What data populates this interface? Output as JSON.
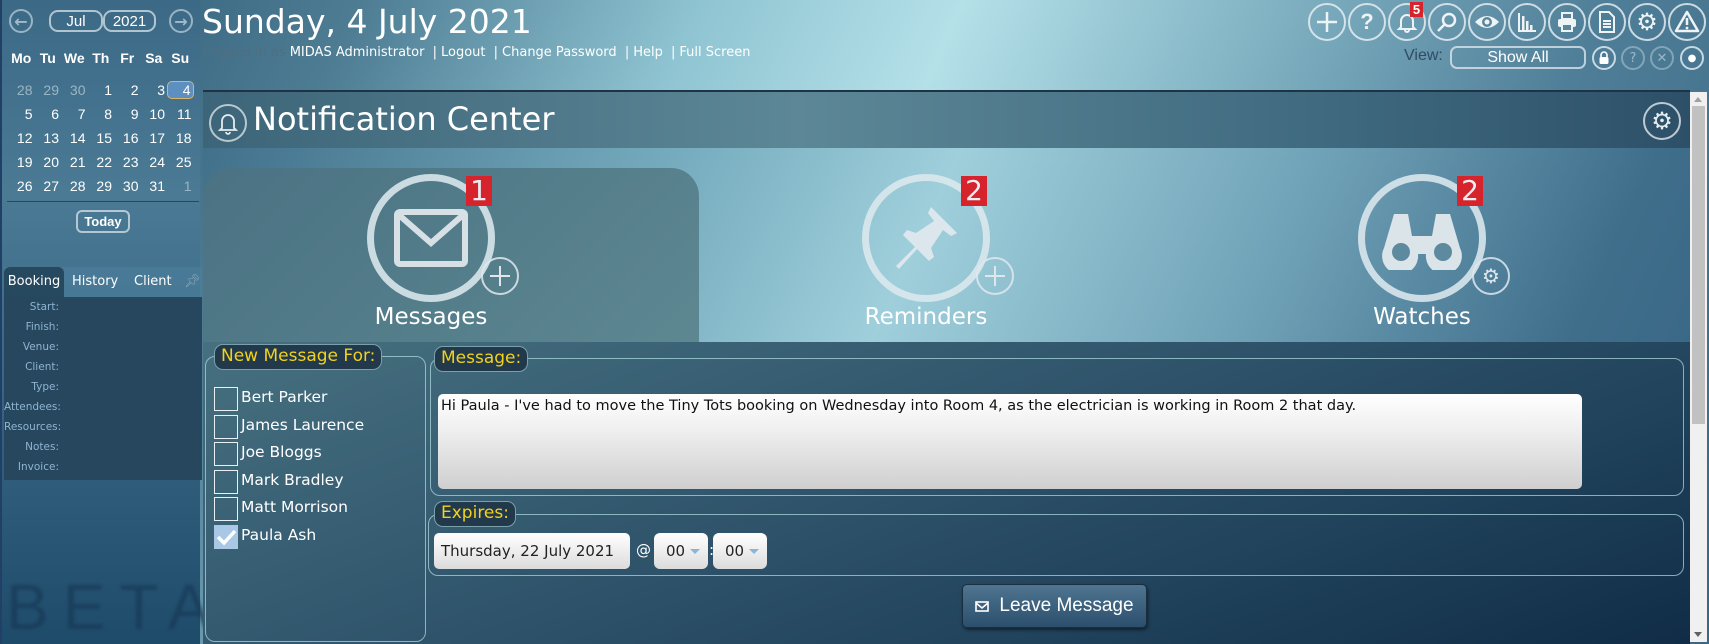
{
  "calendar": {
    "month": "Jul",
    "year": "2021",
    "weekdays": [
      "Mo",
      "Tu",
      "We",
      "Th",
      "Fr",
      "Sa",
      "Su"
    ],
    "weeks": [
      [
        "28",
        "29",
        "30",
        "1",
        "2",
        "3",
        "4"
      ],
      [
        "5",
        "6",
        "7",
        "8",
        "9",
        "10",
        "11"
      ],
      [
        "12",
        "13",
        "14",
        "15",
        "16",
        "17",
        "18"
      ],
      [
        "19",
        "20",
        "21",
        "22",
        "23",
        "24",
        "25"
      ],
      [
        "26",
        "27",
        "28",
        "29",
        "30",
        "31",
        "1"
      ]
    ],
    "selected_day": "4",
    "today_label": "Today"
  },
  "sidebar": {
    "tabs": [
      "Booking",
      "History",
      "Client"
    ],
    "active_tab": "Booking",
    "fields": [
      "Start:",
      "Finish:",
      "Venue:",
      "Client:",
      "Type:",
      "Attendees:",
      "Resources:",
      "Notes:",
      "Invoice:"
    ],
    "watermark": "BETA"
  },
  "header": {
    "date_title": "Sunday, 4 July 2021",
    "logged_in_prefix": "Logged in as",
    "user": "MIDAS Administrator",
    "links": [
      "Logout",
      "Change Password",
      "Help",
      "Full Screen"
    ],
    "toolbar_icons": [
      "add-icon",
      "help-icon",
      "bell-icon",
      "search-icon",
      "eye-icon",
      "chart-icon",
      "print-icon",
      "document-icon",
      "gear-icon",
      "warning-icon"
    ],
    "notification_count": "5",
    "view_label": "View:",
    "view_value": "Show All",
    "small_icons": [
      "lock-icon",
      "help-icon",
      "close-icon",
      "dot-icon"
    ]
  },
  "notification_center": {
    "title": "Notification Center",
    "tabs": [
      {
        "label": "Messages",
        "count": "1",
        "action": "add"
      },
      {
        "label": "Reminders",
        "count": "2",
        "action": "add"
      },
      {
        "label": "Watches",
        "count": "2",
        "action": "settings"
      }
    ],
    "active_tab": "Messages"
  },
  "form": {
    "recipients_legend": "New Message For:",
    "recipients": [
      {
        "name": "Bert Parker",
        "checked": false
      },
      {
        "name": "James Laurence",
        "checked": false
      },
      {
        "name": "Joe Bloggs",
        "checked": false
      },
      {
        "name": "Mark Bradley",
        "checked": false
      },
      {
        "name": "Matt Morrison",
        "checked": false
      },
      {
        "name": "Paula Ash",
        "checked": true
      }
    ],
    "message_legend": "Message:",
    "message": "Hi Paula - I've had to move the Tiny Tots booking on Wednesday into Room 4, as the electrician is working in Room 2 that day.",
    "expires_legend": "Expires:",
    "expires_date": "Thursday, 22 July 2021",
    "at": "@",
    "hour": "00",
    "colon": ":",
    "minute": "00",
    "submit_label": "Leave Message"
  },
  "colors": {
    "badge": "#d6232c",
    "legend_text": "#f3d21b",
    "selected_day": "#5d8fc0"
  }
}
